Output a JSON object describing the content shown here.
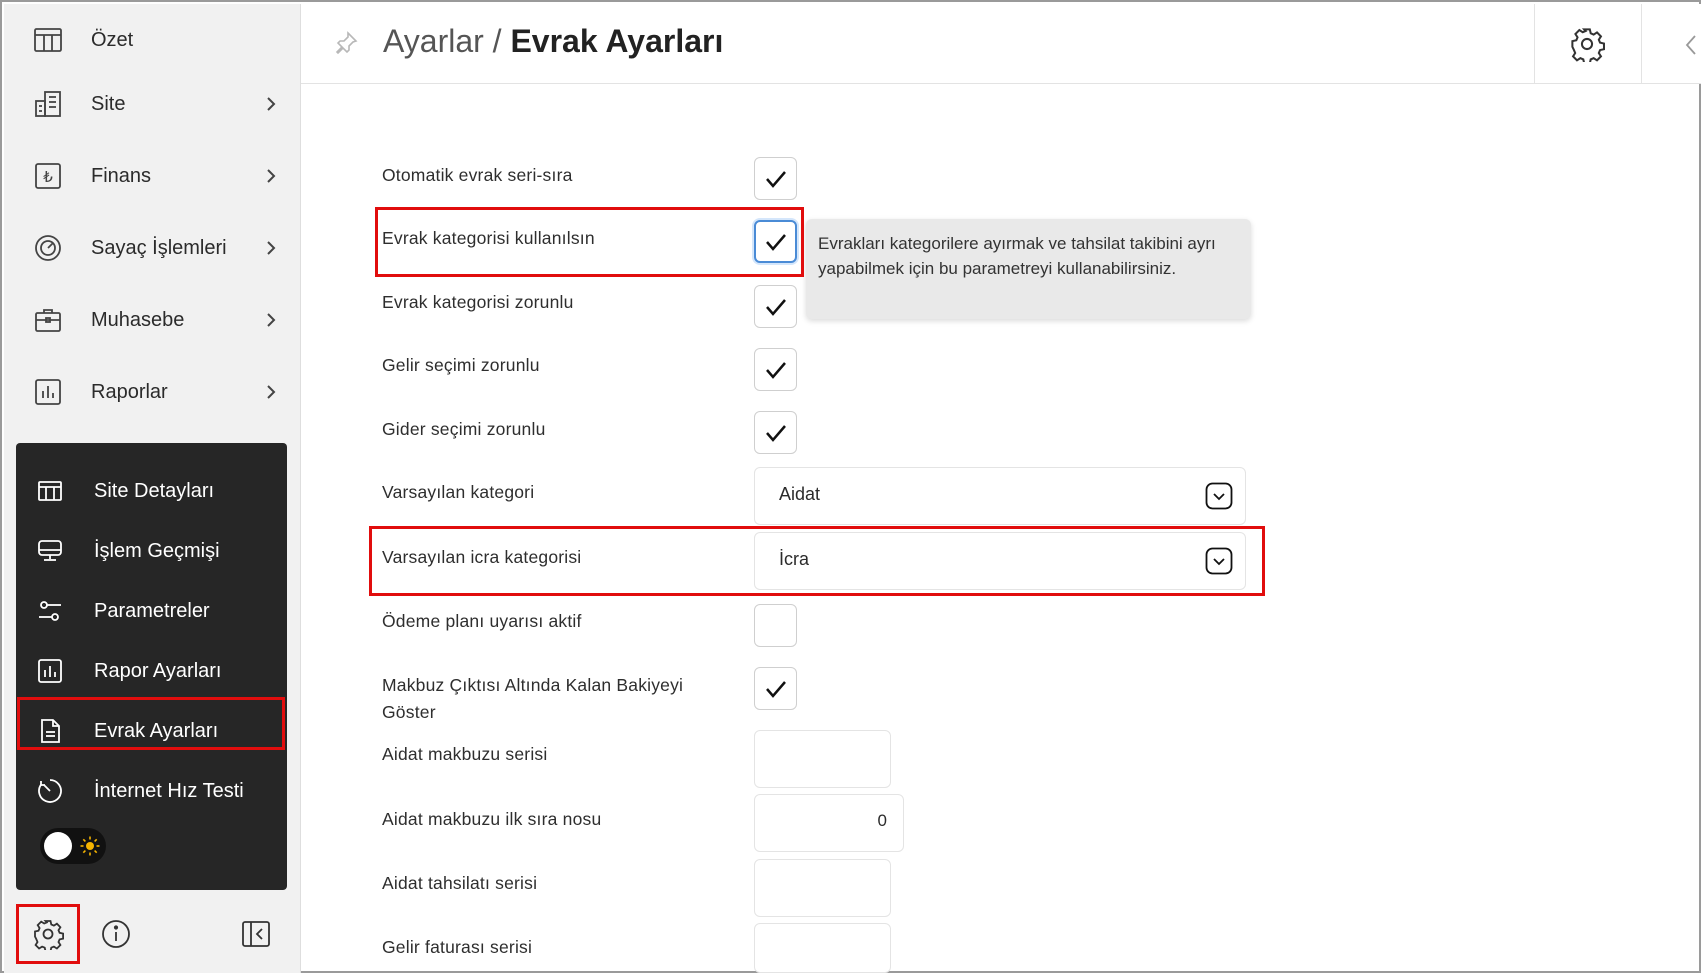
{
  "sidebar": {
    "items": [
      {
        "label": "Özet",
        "icon": "table-icon",
        "has_chevron": false
      },
      {
        "label": "Site",
        "icon": "building-icon",
        "has_chevron": true
      },
      {
        "label": "Finans",
        "icon": "lira-icon",
        "has_chevron": true
      },
      {
        "label": "Sayaç İşlemleri",
        "icon": "gauge-icon",
        "has_chevron": true
      },
      {
        "label": "Muhasebe",
        "icon": "briefcase-icon",
        "has_chevron": true
      },
      {
        "label": "Raporlar",
        "icon": "bar-chart-icon",
        "has_chevron": true
      }
    ],
    "submenu": [
      {
        "label": "Site Detayları",
        "icon": "table-icon"
      },
      {
        "label": "İşlem Geçmişi",
        "icon": "monitor-icon"
      },
      {
        "label": "Parametreler",
        "icon": "sliders-icon"
      },
      {
        "label": "Rapor Ayarları",
        "icon": "bar-chart-icon"
      },
      {
        "label": "Evrak Ayarları",
        "icon": "document-icon",
        "active": true
      },
      {
        "label": "İnternet Hız Testi",
        "icon": "speed-icon"
      }
    ],
    "theme_toggle": {
      "state": "light",
      "icon": "sun-icon"
    },
    "bottom": [
      "gear-icon",
      "info-icon",
      "collapse-panel-icon"
    ]
  },
  "header": {
    "crumb": "Ayarlar",
    "separator": " / ",
    "current": "Evrak Ayarları"
  },
  "form": {
    "rows": [
      {
        "label": "Otomatik evrak seri-sıra",
        "type": "checkbox",
        "checked": true
      },
      {
        "label": "Evrak kategorisi kullanılsın",
        "type": "checkbox",
        "checked": true
      },
      {
        "label": "Evrak kategorisi zorunlu",
        "type": "checkbox",
        "checked": true
      },
      {
        "label": "Gelir seçimi zorunlu",
        "type": "checkbox",
        "checked": true
      },
      {
        "label": "Gider seçimi zorunlu",
        "type": "checkbox",
        "checked": true
      },
      {
        "label": "Varsayılan kategori",
        "type": "select",
        "value": "Aidat"
      },
      {
        "label": "Varsayılan icra kategorisi",
        "type": "select",
        "value": "İcra"
      },
      {
        "label": "Ödeme planı uyarısı aktif",
        "type": "checkbox",
        "checked": false
      },
      {
        "label": "Makbuz Çıktısı Altında Kalan Bakiyeyi",
        "label2": "Göster",
        "type": "checkbox",
        "checked": true
      },
      {
        "label": "Aidat makbuzu serisi",
        "type": "input",
        "value": ""
      },
      {
        "label": "Aidat makbuzu ilk sıra nosu",
        "type": "input",
        "value": "0"
      },
      {
        "label": "Aidat tahsilatı serisi",
        "type": "input",
        "value": ""
      },
      {
        "label": "Gelir faturası serisi",
        "type": "input",
        "value": ""
      }
    ],
    "tooltip": "Evrakları kategorilere ayırmak ve tahsilat takibini ayrı yapabilmek için bu parametreyi kullanabilirsiniz."
  },
  "colors": {
    "highlight": "#e10d0d",
    "sidebar_bg": "#f1f1f1",
    "submenu_bg": "#262626",
    "focus": "#4a8bd6"
  }
}
